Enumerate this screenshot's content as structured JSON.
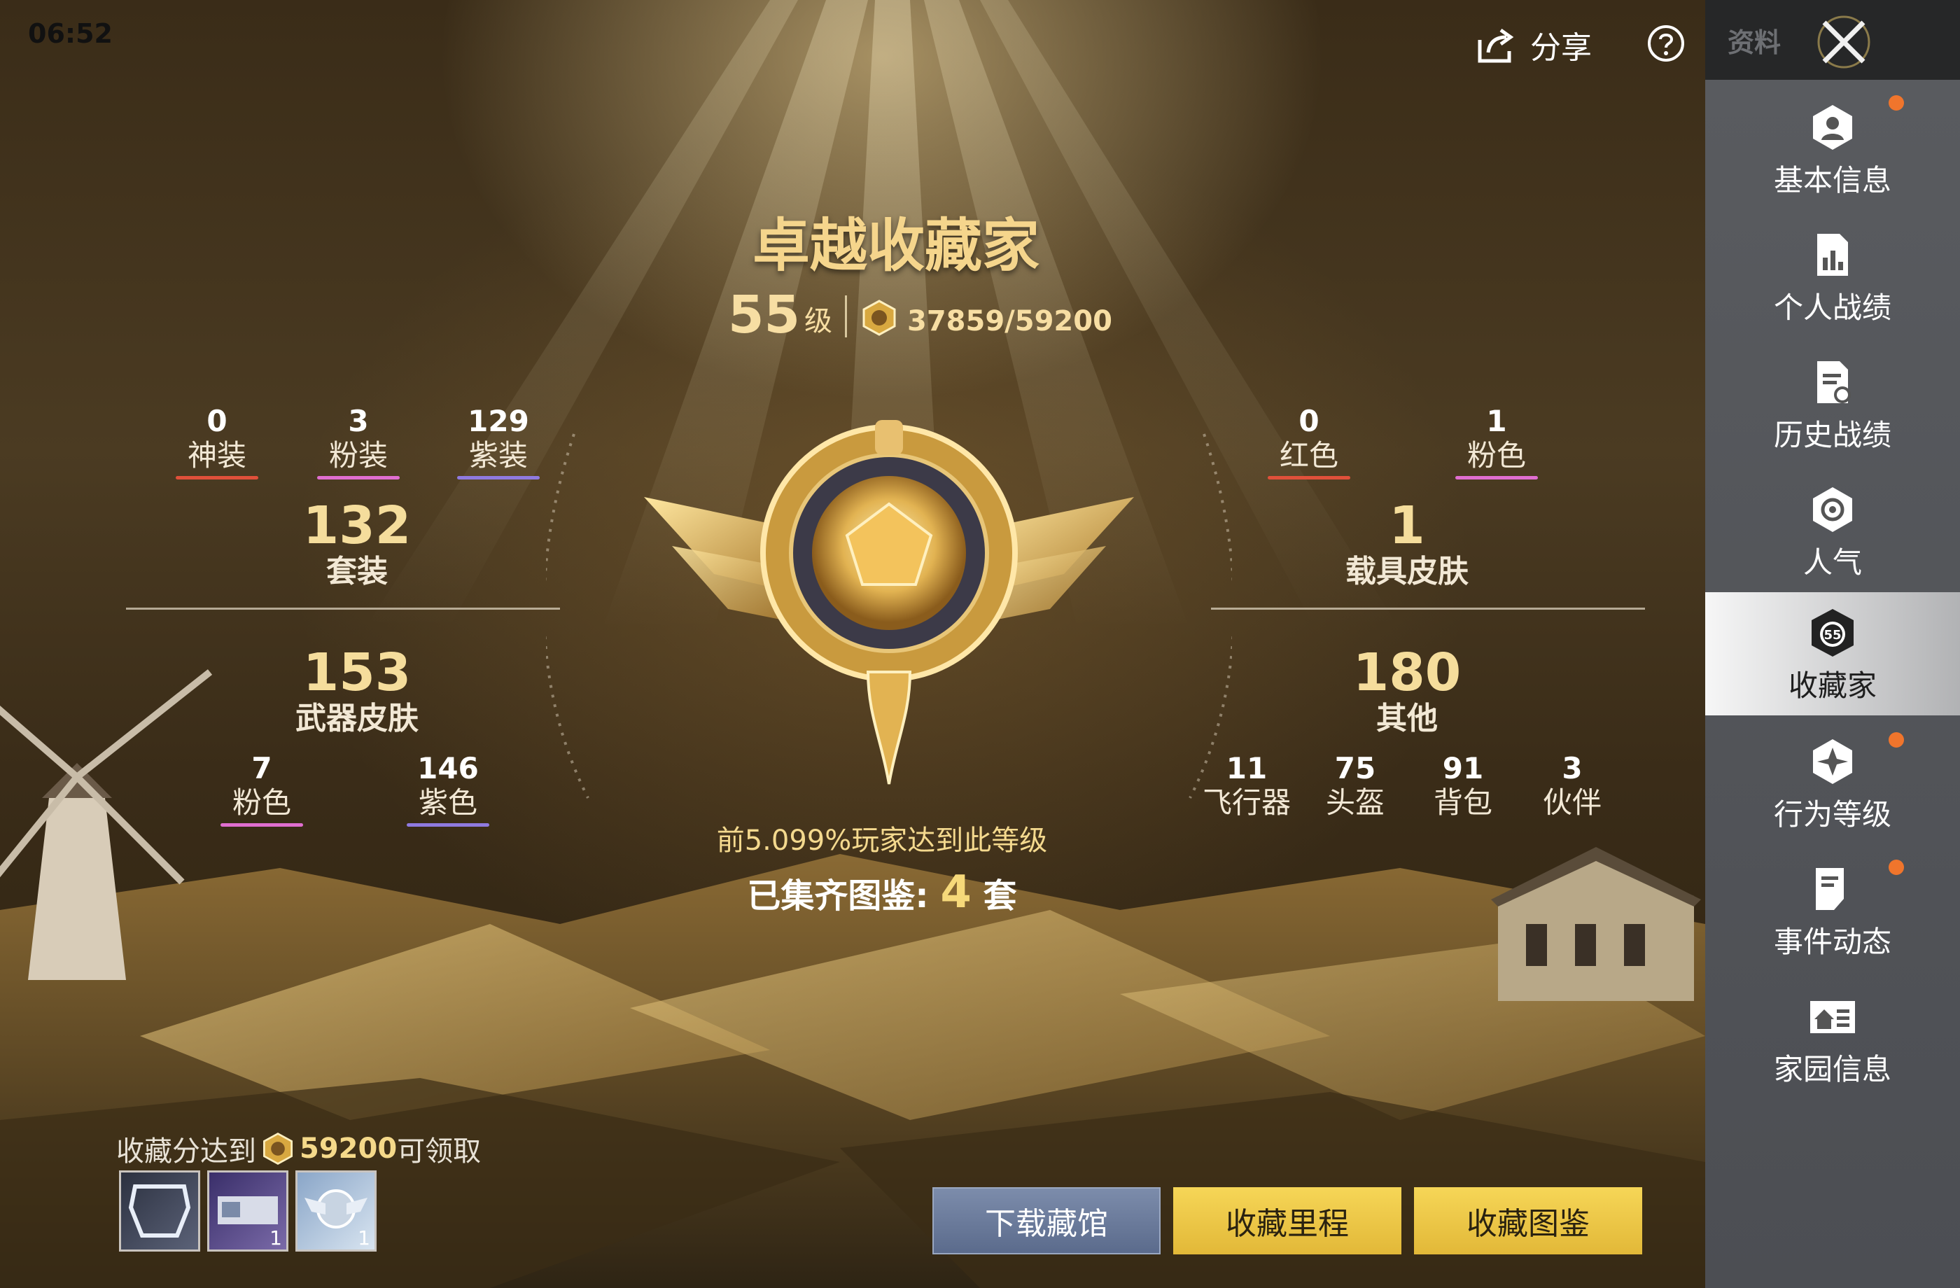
{
  "status": {
    "time": "06:52"
  },
  "header": {
    "share_label": "分享",
    "help_icon": "question-circle-icon"
  },
  "sidebar": {
    "tab_label": "资料",
    "items": [
      {
        "label": "基本信息",
        "icon": "profile-badge-icon",
        "badge": true
      },
      {
        "label": "个人战绩",
        "icon": "stats-chart-icon",
        "badge": false
      },
      {
        "label": "历史战绩",
        "icon": "history-doc-icon",
        "badge": false
      },
      {
        "label": "人气",
        "icon": "popularity-icon",
        "badge": false
      },
      {
        "label": "收藏家",
        "icon": "collector-badge-icon",
        "badge": false,
        "active": true,
        "icon_text": "55"
      },
      {
        "label": "行为等级",
        "icon": "behavior-level-icon",
        "badge": true
      },
      {
        "label": "事件动态",
        "icon": "event-feed-icon",
        "badge": true
      },
      {
        "label": "家园信息",
        "icon": "home-info-icon",
        "badge": false
      }
    ]
  },
  "collector": {
    "title": "卓越收藏家",
    "level": "55",
    "level_unit": "级",
    "score": "37859/59200",
    "rank_text": "前5.099%玩家达到此等级",
    "collected_prefix": "已集齐图鉴:",
    "collected_count": "4",
    "collected_suffix": "套"
  },
  "left_stats": {
    "top": [
      {
        "n": "0",
        "label": "神装",
        "color": "#e0503a"
      },
      {
        "n": "3",
        "label": "粉装",
        "color": "#e06ed0"
      },
      {
        "n": "129",
        "label": "紫装",
        "color": "#8f7ae0"
      }
    ],
    "suits": {
      "n": "132",
      "label": "套装"
    },
    "weapons": {
      "n": "153",
      "label": "武器皮肤"
    },
    "bottom": [
      {
        "n": "7",
        "label": "粉色",
        "color": "#e06ed0"
      },
      {
        "n": "146",
        "label": "紫色",
        "color": "#8f7ae0"
      }
    ]
  },
  "right_stats": {
    "top": [
      {
        "n": "0",
        "label": "红色",
        "color": "#e0503a"
      },
      {
        "n": "1",
        "label": "粉色",
        "color": "#e06ed0"
      }
    ],
    "vehicles": {
      "n": "1",
      "label": "载具皮肤"
    },
    "others": {
      "n": "180",
      "label": "其他"
    },
    "bottom": [
      {
        "n": "11",
        "label": "飞行器"
      },
      {
        "n": "75",
        "label": "头盔"
      },
      {
        "n": "91",
        "label": "背包"
      },
      {
        "n": "3",
        "label": "伙伴"
      }
    ]
  },
  "reward": {
    "prefix": "收藏分达到",
    "points": "59200",
    "suffix": "可领取",
    "items": [
      {
        "name": "frame-reward",
        "count": ""
      },
      {
        "name": "card-reward",
        "count": "1"
      },
      {
        "name": "emblem-reward",
        "count": "1"
      }
    ]
  },
  "buttons": {
    "download": "下载藏馆",
    "milestone": "收藏里程",
    "catalog": "收藏图鉴"
  },
  "colors": {
    "accent_gold": "#f5d58c",
    "badge_orange": "#f0752c"
  }
}
